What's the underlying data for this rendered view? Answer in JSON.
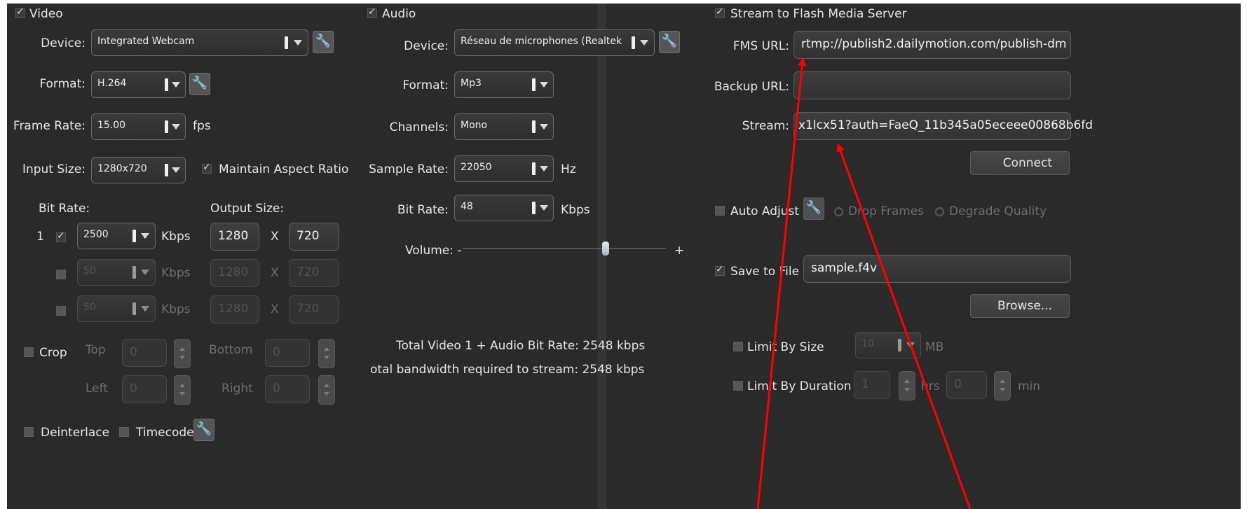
{
  "video": {
    "section_label": "Video",
    "device_label": "Device:",
    "device_value": "Integrated Webcam",
    "format_label": "Format:",
    "format_value": "H.264",
    "frame_rate_label": "Frame Rate:",
    "frame_rate_value": "15.00",
    "fps_unit": "fps",
    "input_size_label": "Input Size:",
    "input_size_value": "1280x720",
    "maintain_aspect_label": "Maintain Aspect Ratio",
    "bit_rate_label": "Bit Rate:",
    "output_size_label": "Output Size:",
    "rows": [
      {
        "index": "1",
        "bitrate": "2500",
        "unit": "Kbps",
        "width": "1280",
        "x": "X",
        "height": "720"
      },
      {
        "index": "",
        "bitrate": "50",
        "unit": "Kbps",
        "width": "1280",
        "x": "X",
        "height": "720"
      },
      {
        "index": "",
        "bitrate": "50",
        "unit": "Kbps",
        "width": "1280",
        "x": "X",
        "height": "720"
      }
    ],
    "crop_label": "Crop",
    "top_label": "Top",
    "bottom_label": "Bottom",
    "left_label": "Left",
    "right_label": "Right",
    "top_value": "0",
    "bottom_value": "0",
    "left_value": "0",
    "right_value": "0",
    "deinterlace_label": "Deinterlace",
    "timecode_label": "Timecode"
  },
  "audio": {
    "section_label": "Audio",
    "device_label": "Device:",
    "device_value": "Réseau de microphones (Realtek",
    "format_label": "Format:",
    "format_value": "Mp3",
    "channels_label": "Channels:",
    "channels_value": "Mono",
    "sample_rate_label": "Sample Rate:",
    "sample_rate_value": "22050",
    "hz_unit": "Hz",
    "bit_rate_label": "Bit Rate:",
    "bit_rate_value": "48",
    "kbps_unit": "Kbps",
    "volume_label": "Volume: -",
    "volume_plus": "+",
    "volume_level": 0.71,
    "total_bitrate_text": "Total Video 1 + Audio Bit Rate:  2548 kbps",
    "total_bandwidth_text": "otal bandwidth required to stream:  2548 kbps"
  },
  "stream": {
    "section_label": "Stream to Flash Media Server",
    "fms_url_label": "FMS URL:",
    "fms_url_value": "rtmp://publish2.dailymotion.com/publish-dm",
    "backup_url_label": "Backup URL:",
    "backup_url_value": "",
    "stream_label": "Stream:",
    "stream_value": "x1lcx51?auth=FaeQ_11b345a05eceee00868b6fd",
    "connect_label": "Connect",
    "auto_adjust_label": "Auto Adjust",
    "drop_frames_label": "Drop Frames",
    "degrade_quality_label": "Degrade Quality",
    "save_to_file_label": "Save to File",
    "save_file_value": "sample.f4v",
    "browse_label": "Browse...",
    "limit_size_label": "Limit By Size",
    "limit_size_value": "10",
    "mb_unit": "MB",
    "limit_duration_label": "Limit By Duration",
    "hrs_value": "1",
    "hrs_unit": "hrs",
    "min_value": "0",
    "min_unit": "min"
  },
  "colors": {
    "panel_bg": "#2a2a2a",
    "annotation_arrow": "#ff0000"
  }
}
